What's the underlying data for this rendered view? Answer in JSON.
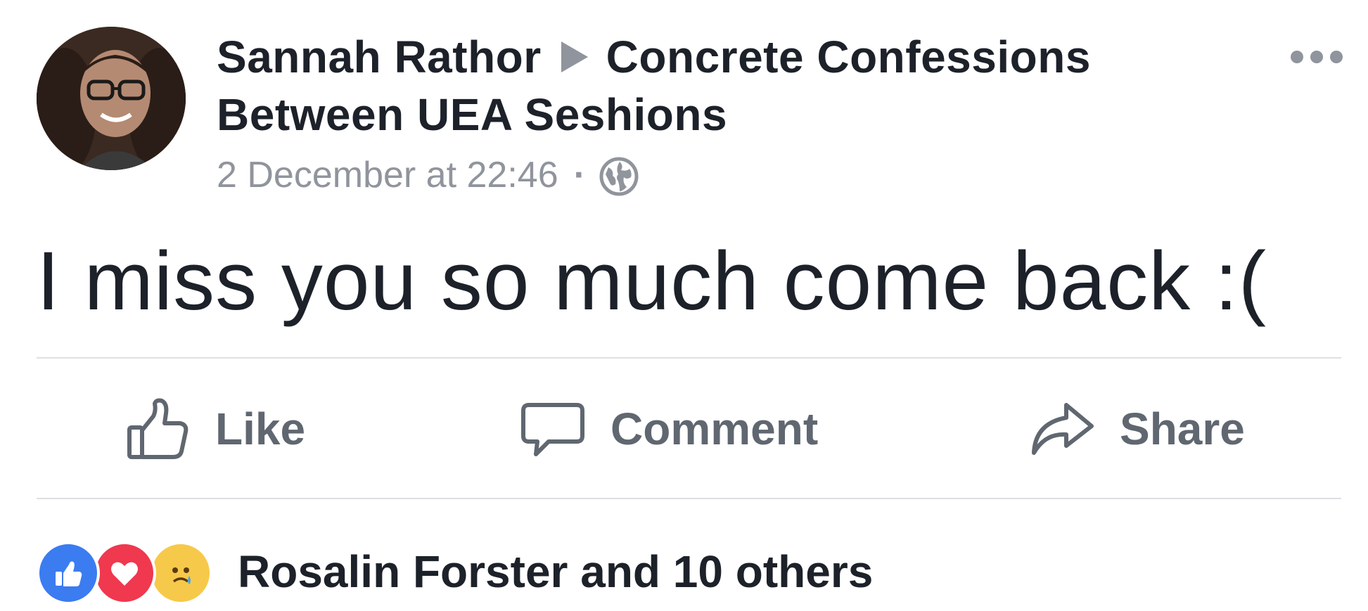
{
  "post": {
    "author": "Sannah Rathor",
    "group": "Concrete Confessions Between UEA Seshions",
    "timestamp": "2 December at 22:46",
    "separator": "·",
    "privacy_icon": "globe-icon",
    "message": "I miss you so much come back :("
  },
  "actions": {
    "like_label": "Like",
    "comment_label": "Comment",
    "share_label": "Share"
  },
  "reactions": {
    "types": [
      "like",
      "love",
      "sad"
    ],
    "summary": "Rosalin Forster and 10 others"
  },
  "colors": {
    "text": "#1d2129",
    "secondary": "#90949c",
    "action": "#606770",
    "like_blue": "#3b7cf0",
    "love_red": "#f0384f",
    "sad_yellow": "#f7c94a"
  }
}
